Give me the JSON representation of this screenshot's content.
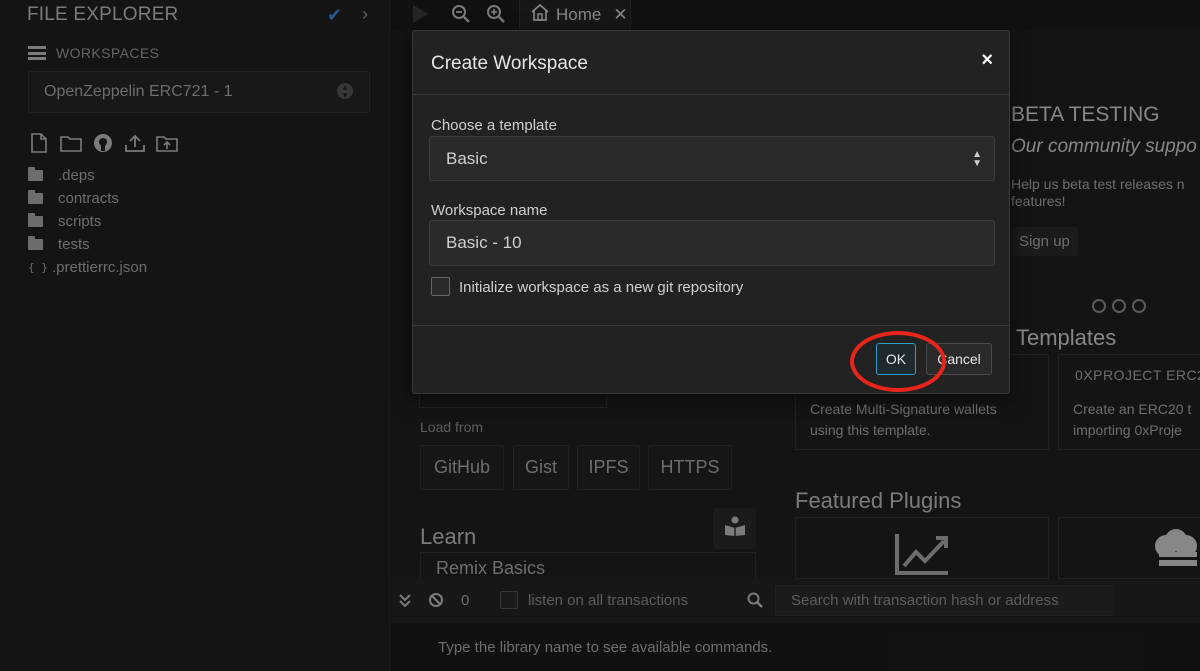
{
  "sidebar": {
    "title": "FILE EXPLORER",
    "workspaces_label": "WORKSPACES",
    "selected_workspace": "OpenZeppelin ERC721 - 1",
    "files": [
      {
        "type": "folder",
        "name": ".deps"
      },
      {
        "type": "folder",
        "name": "contracts"
      },
      {
        "type": "folder",
        "name": "scripts"
      },
      {
        "type": "folder",
        "name": "tests"
      },
      {
        "type": "json",
        "name": ".prettierrc.json"
      }
    ]
  },
  "topbar": {
    "home_tab": "Home"
  },
  "home": {
    "beta_title": "BETA TESTING",
    "beta_subtitle": "Our community suppo",
    "beta_text_1": "Help us beta test releases n",
    "beta_text_2": "features!",
    "signup_label": "Sign up",
    "templates_title": "Templates",
    "template_cards": [
      {
        "title": "",
        "desc_1": "Create Multi-Signature wallets",
        "desc_2": "using this template."
      },
      {
        "title": "0XPROJECT ERC2",
        "desc_1": "Create an ERC20 t",
        "desc_2": "importing 0xProje"
      }
    ],
    "load_from_label": "Load from",
    "load_buttons": [
      "GitHub",
      "Gist",
      "IPFS",
      "HTTPS"
    ],
    "featured_plugins_title": "Featured Plugins",
    "learn_title": "Learn",
    "learn_item": "Remix Basics"
  },
  "terminal": {
    "count": "0",
    "listen_label": "listen on all transactions",
    "search_placeholder": "Search with transaction hash or address",
    "hint": "Type the library name to see available commands."
  },
  "modal": {
    "title": "Create Workspace",
    "close_label": "×",
    "template_label": "Choose a template",
    "template_value": "Basic",
    "name_label": "Workspace name",
    "name_value": "Basic - 10",
    "git_checkbox_label": "Initialize workspace as a new git repository",
    "ok_label": "OK",
    "cancel_label": "Cancel"
  },
  "colors": {
    "accent": "#2e9ec9",
    "highlight_ring": "#e8251b",
    "check": "#3b8bd6"
  }
}
